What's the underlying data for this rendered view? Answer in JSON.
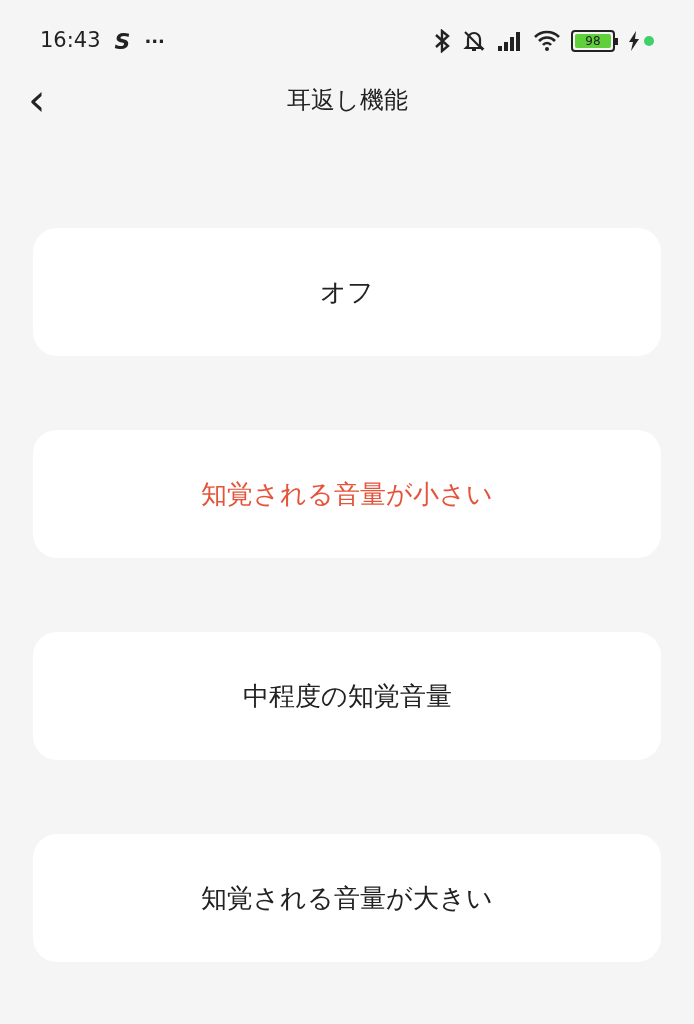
{
  "status_bar": {
    "time": "16:43",
    "notification_app": "S",
    "more": "···",
    "battery": "98",
    "charging": true
  },
  "header": {
    "back": "‹",
    "title": "耳返し機能"
  },
  "options": [
    {
      "label": "オフ",
      "selected": false
    },
    {
      "label": "知覚される音量が小さい",
      "selected": true
    },
    {
      "label": "中程度の知覚音量",
      "selected": false
    },
    {
      "label": "知覚される音量が大きい",
      "selected": false
    }
  ]
}
